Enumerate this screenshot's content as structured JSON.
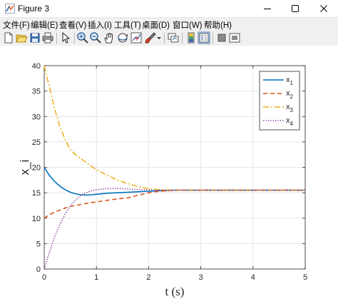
{
  "window": {
    "title": "Figure 3"
  },
  "menu": {
    "items": [
      {
        "label": "文件(F)"
      },
      {
        "label": "编辑(E)"
      },
      {
        "label": "查看(V)"
      },
      {
        "label": "插入(I)"
      },
      {
        "label": "工具(T)"
      },
      {
        "label": "桌面(D)"
      },
      {
        "label": "窗口(W)"
      },
      {
        "label": "帮助(H)"
      }
    ]
  },
  "toolbar": {
    "icons": [
      "new-figure-icon",
      "open-file-icon",
      "save-icon",
      "print-icon",
      "pointer-icon",
      "zoom-in-icon",
      "zoom-out-icon",
      "pan-icon",
      "rotate-3d-icon",
      "data-cursor-icon",
      "brush-icon",
      "dropdown-arrow-icon",
      "link-plot-icon",
      "insert-colorbar-icon",
      "insert-legend-icon",
      "hide-plot-tools-icon",
      "show-plot-tools-icon"
    ]
  },
  "colors": {
    "x1": "#0072BD",
    "x2": "#D95319",
    "x3": "#EDB120",
    "x4": "#7E2F8E",
    "grid": "#e5e5e5",
    "axis": "#262626"
  },
  "chart_data": {
    "type": "line",
    "title": "",
    "xlabel": "t (s)",
    "ylabel": "x_i",
    "xlim": [
      0,
      5
    ],
    "ylim": [
      0,
      40
    ],
    "xticks": [
      0,
      1,
      2,
      3,
      4,
      5
    ],
    "yticks": [
      0,
      5,
      10,
      15,
      20,
      25,
      30,
      35,
      40
    ],
    "grid": true,
    "legend_position": "top-right",
    "series": [
      {
        "name": "x1",
        "label_main": "x",
        "label_sub": "1",
        "style": "solid",
        "x": [
          0,
          0.1,
          0.2,
          0.3,
          0.4,
          0.5,
          0.6,
          0.7,
          0.8,
          0.9,
          1.0,
          1.2,
          1.4,
          1.6,
          1.8,
          2.0,
          2.2,
          2.5,
          3.0,
          4.0,
          5.0
        ],
        "values": [
          20,
          18.4,
          17.2,
          16.3,
          15.6,
          15.1,
          14.8,
          14.6,
          14.55,
          14.6,
          14.7,
          14.9,
          15.0,
          15.1,
          15.2,
          15.3,
          15.4,
          15.5,
          15.5,
          15.5,
          15.5
        ]
      },
      {
        "name": "x2",
        "label_main": "x",
        "label_sub": "2",
        "style": "dashed",
        "x": [
          0,
          0.1,
          0.2,
          0.3,
          0.4,
          0.5,
          0.6,
          0.7,
          0.8,
          1.0,
          1.2,
          1.4,
          1.6,
          1.8,
          2.0,
          2.2,
          2.5,
          3.0,
          4.0,
          5.0
        ],
        "values": [
          10,
          10.7,
          11.2,
          11.6,
          12.0,
          12.3,
          12.5,
          12.7,
          12.9,
          13.2,
          13.5,
          13.8,
          14.0,
          14.5,
          15.0,
          15.3,
          15.5,
          15.5,
          15.5,
          15.5
        ]
      },
      {
        "name": "x3",
        "label_main": "x",
        "label_sub": "3",
        "style": "dashdot",
        "x": [
          0,
          0.1,
          0.2,
          0.3,
          0.4,
          0.5,
          0.6,
          0.8,
          1.0,
          1.2,
          1.4,
          1.6,
          1.8,
          2.0,
          2.2,
          2.5,
          3.0,
          4.0,
          5.0
        ],
        "values": [
          40,
          35.8,
          31.5,
          28.0,
          25.5,
          23.5,
          22.5,
          21.0,
          19.5,
          18.5,
          17.5,
          16.8,
          16.2,
          15.8,
          15.6,
          15.5,
          15.5,
          15.5,
          15.5
        ]
      },
      {
        "name": "x4",
        "label_main": "x",
        "label_sub": "4",
        "style": "dotted",
        "x": [
          0,
          0.1,
          0.2,
          0.3,
          0.4,
          0.5,
          0.6,
          0.7,
          0.8,
          0.9,
          1.0,
          1.2,
          1.4,
          1.6,
          1.8,
          2.0,
          2.2,
          2.5,
          3.0,
          4.0,
          5.0
        ],
        "values": [
          0,
          3.3,
          6.3,
          8.8,
          10.8,
          12.4,
          13.6,
          14.5,
          15.0,
          15.4,
          15.6,
          15.8,
          15.85,
          15.75,
          15.65,
          15.55,
          15.5,
          15.5,
          15.5,
          15.5,
          15.5
        ]
      }
    ]
  }
}
